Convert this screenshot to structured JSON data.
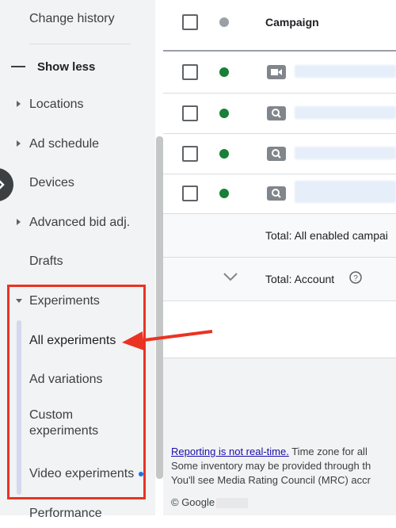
{
  "sidebar": {
    "change_history": "Change history",
    "show_less": "Show less",
    "locations": "Locations",
    "ad_schedule": "Ad schedule",
    "devices": "Devices",
    "advanced_bid": "Advanced bid adj.",
    "drafts": "Drafts",
    "experiments": "Experiments",
    "all_experiments": "All experiments",
    "ad_variations": "Ad variations",
    "custom_experiments_line1": "Custom",
    "custom_experiments_line2": "experiments",
    "video_experiments": "Video experiments",
    "performance": "Performance"
  },
  "table": {
    "header_campaign": "Campaign",
    "rows": [
      {
        "status": "enabled",
        "type": "video-icon"
      },
      {
        "status": "enabled",
        "type": "search-icon"
      },
      {
        "status": "enabled",
        "type": "search-icon"
      },
      {
        "status": "enabled",
        "type": "search-icon"
      }
    ],
    "total_enabled": "Total: All enabled campai",
    "total_account": "Total: Account"
  },
  "footer": {
    "reporting_link": "Reporting is not real-time.",
    "reporting_rest": " Time zone for all",
    "line2": "Some inventory may be provided through th",
    "line3": "You'll see Media Rating Council (MRC) accr",
    "copyright": "© Google"
  },
  "colors": {
    "status_enabled": "#188038",
    "status_header": "#9aa0a6",
    "annotation": "#ea3323"
  }
}
